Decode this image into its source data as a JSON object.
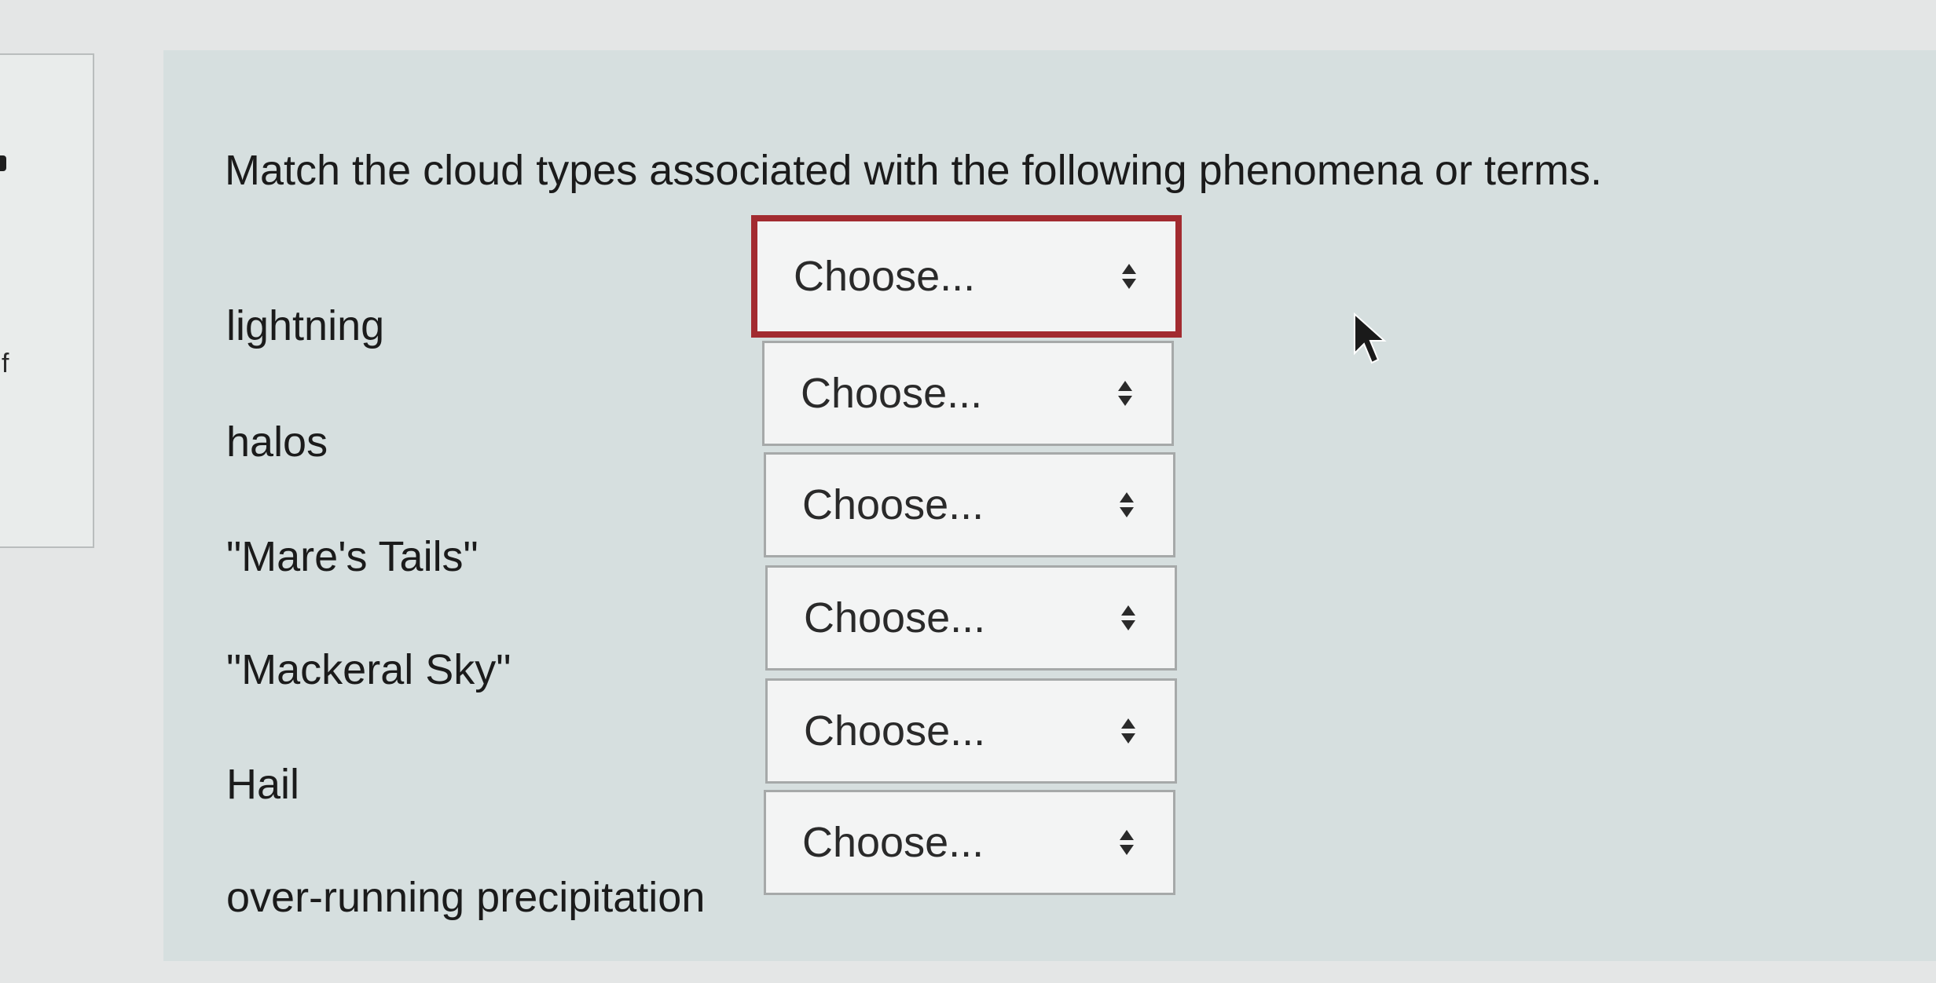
{
  "left_edge": {
    "char": "f"
  },
  "question": {
    "prompt": "Match the cloud types associated with the following phenomena or terms.",
    "rows": [
      {
        "label": "lightning",
        "selected": "Choose...",
        "focused": true
      },
      {
        "label": "halos",
        "selected": "Choose...",
        "focused": false
      },
      {
        "label": "\"Mare's Tails\"",
        "selected": "Choose...",
        "focused": false
      },
      {
        "label": "\"Mackeral Sky\"",
        "selected": "Choose...",
        "focused": false
      },
      {
        "label": "Hail",
        "selected": "Choose...",
        "focused": false
      },
      {
        "label": "over-running precipitation",
        "selected": "Choose...",
        "focused": false
      }
    ]
  },
  "colors": {
    "focus_border": "#a22b30",
    "panel_background": "#d6dfdf",
    "select_background": "#f3f4f4"
  },
  "icons": {
    "select_arrows": "up-down-arrows-icon",
    "cursor": "mouse-pointer-icon"
  }
}
